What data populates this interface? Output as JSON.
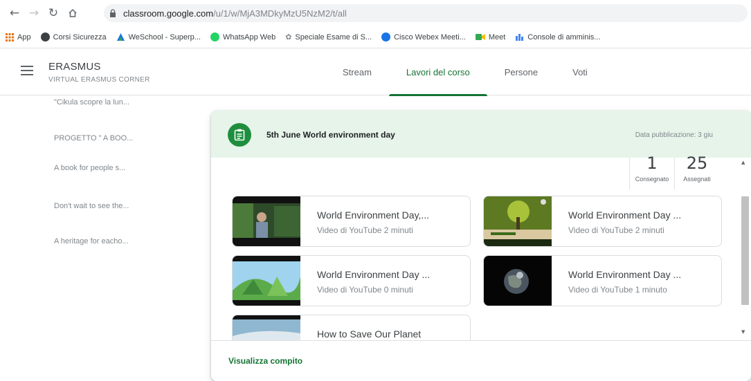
{
  "browser": {
    "url_host": "classroom.google.com",
    "url_path": "/u/1/w/MjA3MDkyMzU5NzM2/t/all",
    "bookmarks": [
      {
        "label": "App",
        "icon": "apps-grid-icon",
        "color": "#e8710a"
      },
      {
        "label": "Corsi Sicurezza",
        "icon": "globe-icon",
        "color": "#3c4043"
      },
      {
        "label": "WeSchool - Superp...",
        "icon": "weschool-icon",
        "color": "#1a73e8"
      },
      {
        "label": "WhatsApp Web",
        "icon": "whatsapp-icon",
        "color": "#25d366"
      },
      {
        "label": "Speciale Esame di S...",
        "icon": "spark-icon",
        "color": "#80868b"
      },
      {
        "label": "Cisco Webex Meeti...",
        "icon": "webex-icon",
        "color": "#1a73e8"
      },
      {
        "label": "Meet",
        "icon": "meet-icon",
        "color": "#34a853"
      },
      {
        "label": "Console di amminis...",
        "icon": "admin-console-icon",
        "color": "#4285f4"
      }
    ]
  },
  "header": {
    "class_name": "ERASMUS",
    "class_section": "VIRTUAL ERASMUS CORNER",
    "tabs": [
      {
        "label": "Stream",
        "active": false
      },
      {
        "label": "Lavori del corso",
        "active": true
      },
      {
        "label": "Persone",
        "active": false
      },
      {
        "label": "Voti",
        "active": false
      }
    ]
  },
  "topics": [
    "\"Cikula scopre la lun...",
    "PROGETTO \" A BOO...",
    "A book for people s...",
    "Don't wait to see the...",
    "A heritage for eacho..."
  ],
  "assignment": {
    "title": "5th June World environment day",
    "posted": "Data pubblicazione: 3 giu",
    "turned_in_count": "1",
    "turned_in_label": "Consegnato",
    "assigned_count": "25",
    "assigned_label": "Assegnati",
    "attachments": [
      {
        "title": "World Environment Day,...",
        "subtitle": "Video di YouTube   2 minuti"
      },
      {
        "title": "World Environment Day ...",
        "subtitle": "Video di YouTube   2 minuti"
      },
      {
        "title": "World Environment Day ...",
        "subtitle": "Video di YouTube   0 minuti"
      },
      {
        "title": "World Environment Day ...",
        "subtitle": "Video di YouTube   1 minuto"
      },
      {
        "title": "How to Save Our Planet",
        "subtitle": ""
      }
    ],
    "view_label": "Visualizza compito"
  },
  "colors": {
    "accent": "#137333",
    "header_band": "#e6f4ea",
    "assignment_icon": "#1e8e3e"
  }
}
